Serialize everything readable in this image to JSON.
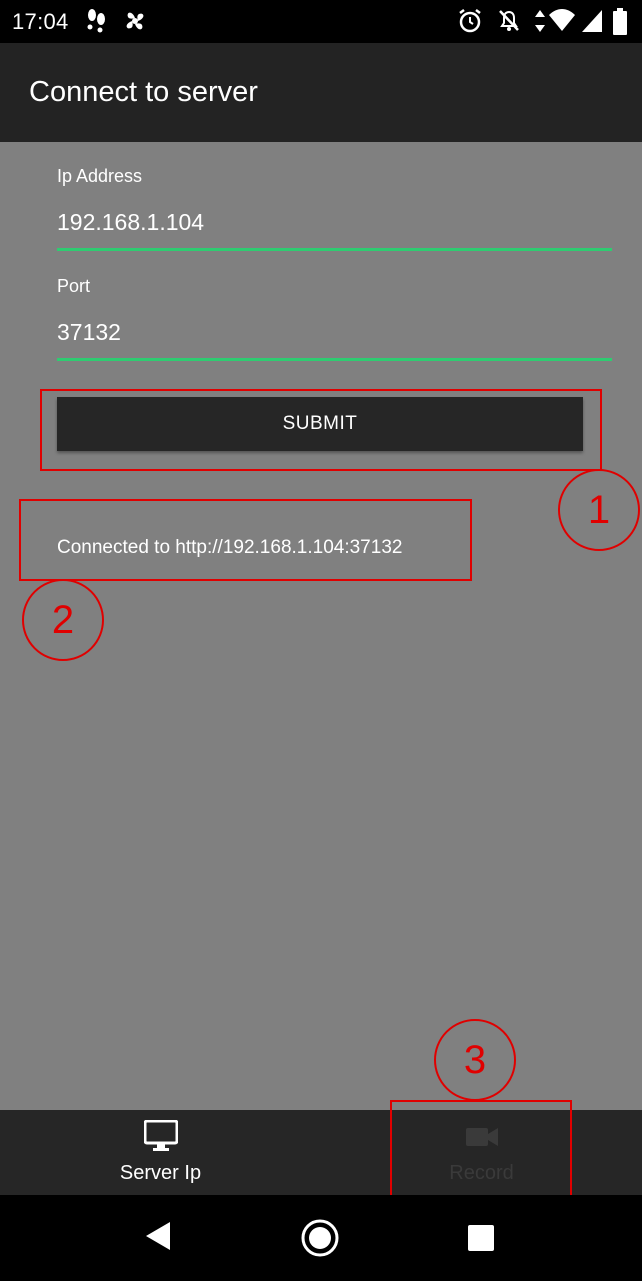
{
  "status_bar": {
    "time": "17:04",
    "icons": [
      "steps-icon",
      "fan-icon",
      "alarm-icon",
      "notifications-off-icon",
      "data-arrows-icon",
      "wifi-icon",
      "signal-icon",
      "battery-icon"
    ]
  },
  "app_bar": {
    "title": "Connect to server"
  },
  "form": {
    "ip_label": "Ip Address",
    "ip_value": "192.168.1.104",
    "port_label": "Port",
    "port_value": "37132",
    "submit_label": "SUBMIT"
  },
  "status_message": "Connected to http://192.168.1.104:37132",
  "annotations": [
    "1",
    "2",
    "3"
  ],
  "bottom_nav": {
    "items": [
      {
        "label": "Server Ip",
        "icon": "monitor-icon",
        "active": true
      },
      {
        "label": "Record",
        "icon": "video-camera-icon",
        "active": false
      }
    ]
  },
  "system_nav": [
    "back-icon",
    "home-icon",
    "recents-icon"
  ],
  "colors": {
    "background": "#808080",
    "app_bar": "#232323",
    "accent_underline": "#2ecc71",
    "annotation": "#e00000",
    "nav_active": "#ffffff",
    "nav_inactive": "#3a3a3a"
  }
}
